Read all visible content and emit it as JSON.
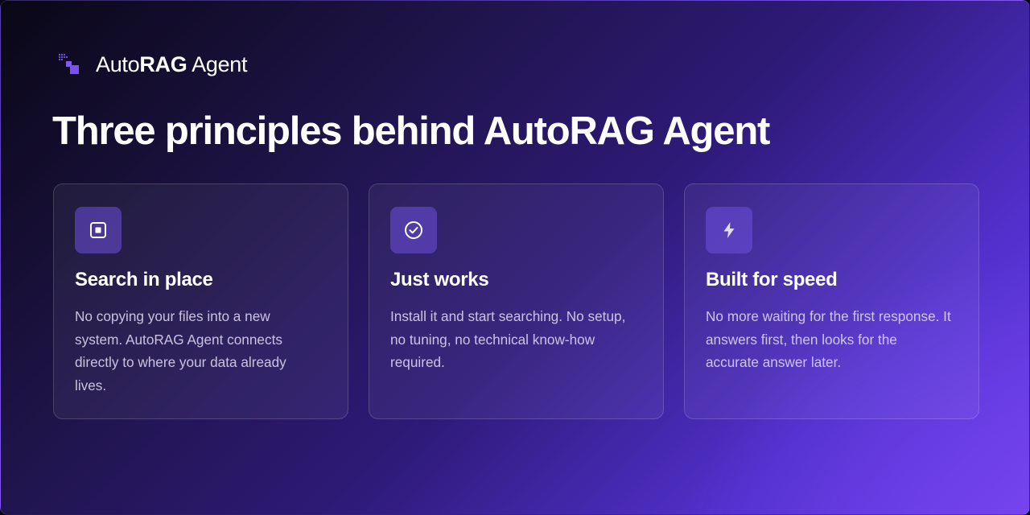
{
  "brand": {
    "logo_icon": "pixel-squares-logo-icon",
    "name_prefix": "Auto",
    "name_emphasis": "RAG",
    "name_suffix": " Agent"
  },
  "headline": "Three principles behind AutoRAG Agent",
  "colors": {
    "accent": "#7b4ff0",
    "icon_box": "#4a34a8",
    "text_primary": "#ffffff",
    "text_secondary": "#ddd6f3"
  },
  "cards": [
    {
      "icon": "square-in-box-icon",
      "title": "Search in place",
      "body": "No copying your files into a new system. AutoRAG Agent connects directly to where your data already lives."
    },
    {
      "icon": "check-circle-icon",
      "title": "Just works",
      "body": "Install it and start searching. No setup, no tuning, no technical know-how required."
    },
    {
      "icon": "lightning-bolt-icon",
      "title": "Built for speed",
      "body": "No more waiting for the first response. It answers first, then looks for the accurate answer later."
    }
  ]
}
